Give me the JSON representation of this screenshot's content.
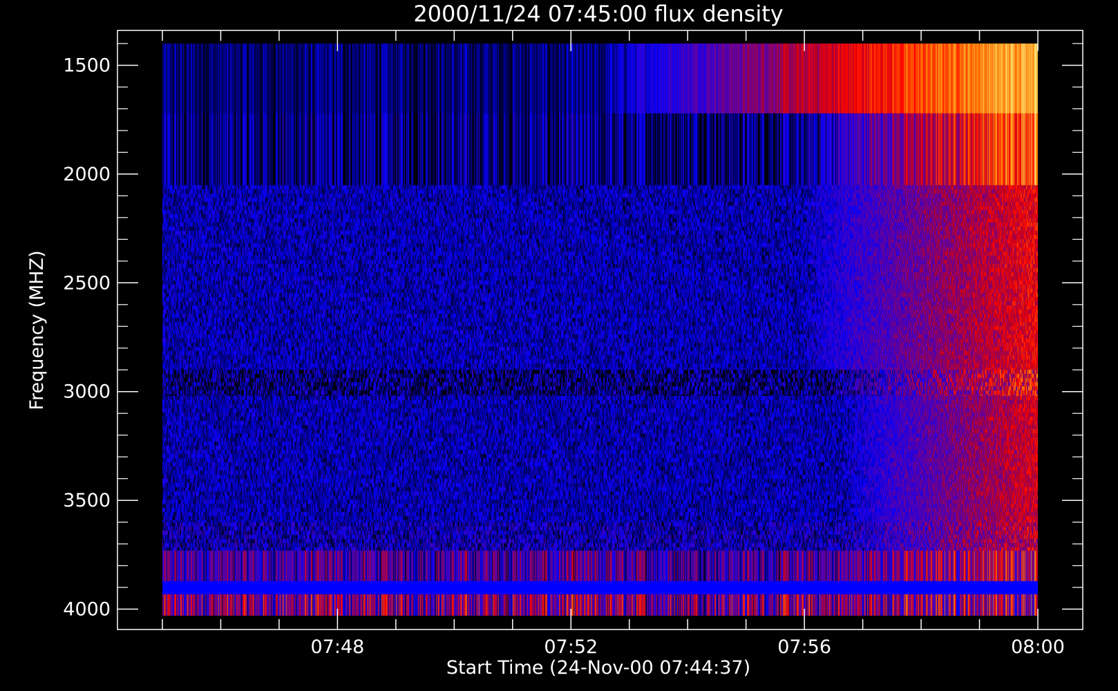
{
  "chart_data": {
    "type": "heatmap",
    "title": "2000/11/24 07:45:00 flux density",
    "xlabel": "Start Time (24-Nov-00 07:44:37)",
    "ylabel": "Frequency (MHZ)",
    "x_range": [
      "07:44:37",
      "08:00:05"
    ],
    "y_range": [
      4030,
      1400
    ],
    "y_ticks": [
      1500,
      2000,
      2500,
      3000,
      3500,
      4000
    ],
    "x_ticks": [
      "07:48",
      "07:52",
      "07:56",
      "08:00"
    ],
    "x_minor_ticks": [
      "07:45",
      "07:46",
      "07:47",
      "07:48",
      "07:49",
      "07:50",
      "07:51",
      "07:52",
      "07:53",
      "07:54",
      "07:55",
      "07:56",
      "07:57",
      "07:58",
      "07:59",
      "08:00"
    ],
    "data_time_range": [
      "07:45:00",
      "08:00:00"
    ],
    "colors": {
      "background": "#000000",
      "axes": "#ffffff",
      "low": "#0000ff",
      "mid": "#ff0000",
      "high": "#ffa500"
    },
    "frequency_bands": [
      {
        "from": 1400,
        "to": 1720,
        "start_level": 0.12,
        "end_level": 0.95,
        "rise_start": "07:52:30",
        "noise": 0.1,
        "stripy": true
      },
      {
        "from": 1720,
        "to": 2050,
        "start_level": 0.13,
        "end_level": 0.85,
        "rise_start": "07:56:00",
        "noise": 0.18,
        "stripy": true
      },
      {
        "from": 2050,
        "to": 2900,
        "start_level": 0.18,
        "end_level": 0.66,
        "rise_start": "07:56:00",
        "noise": 0.12,
        "stripy": false
      },
      {
        "from": 2900,
        "to": 3020,
        "start_level": 0.12,
        "end_level": 0.68,
        "rise_start": "07:56:20",
        "noise": 0.22,
        "stripy": false
      },
      {
        "from": 3020,
        "to": 3600,
        "start_level": 0.18,
        "end_level": 0.62,
        "rise_start": "07:56:40",
        "noise": 0.12,
        "stripy": false
      },
      {
        "from": 3600,
        "to": 3730,
        "start_level": 0.2,
        "end_level": 0.6,
        "rise_start": "07:56:40",
        "noise": 0.18,
        "stripy": false
      },
      {
        "from": 3730,
        "to": 3870,
        "start_level": 0.35,
        "end_level": 0.62,
        "rise_start": "07:56:30",
        "noise": 0.28,
        "stripy": true
      },
      {
        "from": 3870,
        "to": 3930,
        "start_level": 0.22,
        "end_level": 0.22,
        "rise_start": "08:00:00",
        "noise": 0.0,
        "stripy": false
      },
      {
        "from": 3930,
        "to": 4030,
        "start_level": 0.45,
        "end_level": 0.55,
        "rise_start": "07:57:00",
        "noise": 0.35,
        "stripy": true
      }
    ]
  }
}
